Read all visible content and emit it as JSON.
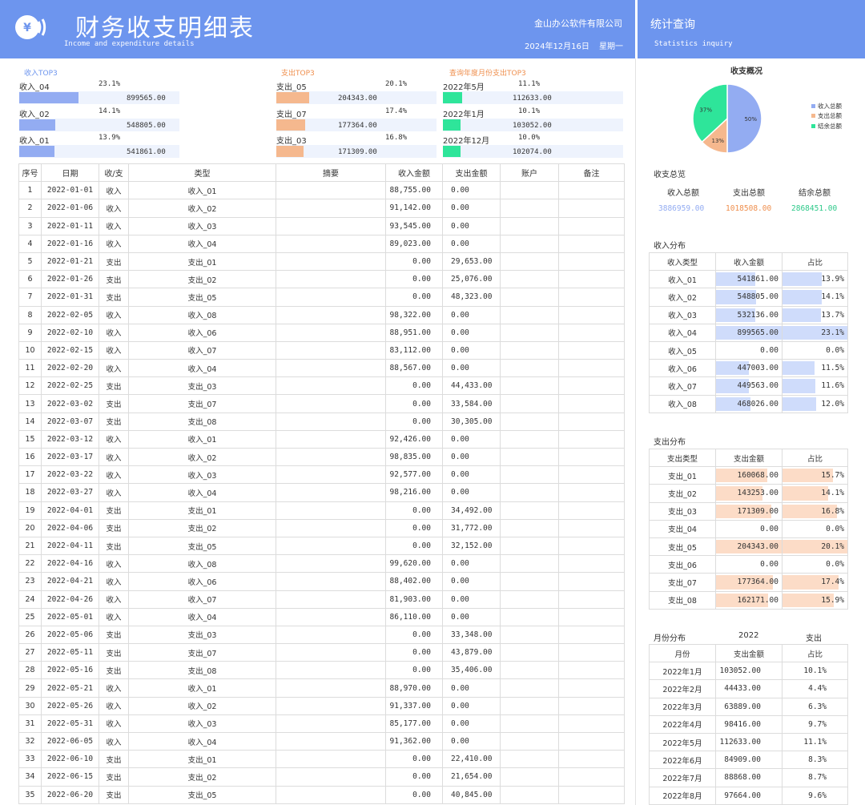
{
  "header": {
    "title": "财务收支明细表",
    "subtitle": "Income and expenditure details",
    "company": "金山办公软件有限公司",
    "date": "2024年12月16日",
    "weekday": "星期一",
    "logo_symbol": "¥"
  },
  "side_header": {
    "title": "统计查询",
    "subtitle": "Statistics  inquiry"
  },
  "colors": {
    "header": "#6d95ee",
    "income": "#93acf2",
    "expense": "#f5b88e",
    "balance": "#2ee59a",
    "income_fill": "#cfdcfb",
    "expense_fill": "#fcdcc7"
  },
  "top3": {
    "income": {
      "title": "收入TOP3",
      "items": [
        {
          "name": "收入_04",
          "pct": "23.1%",
          "amount": "899565.00",
          "ratio": 0.231
        },
        {
          "name": "收入_02",
          "pct": "14.1%",
          "amount": "548805.00",
          "ratio": 0.141
        },
        {
          "name": "收入_01",
          "pct": "13.9%",
          "amount": "541861.00",
          "ratio": 0.139
        }
      ]
    },
    "expense": {
      "title": "支出TOP3",
      "items": [
        {
          "name": "支出_05",
          "pct": "20.1%",
          "amount": "204343.00",
          "ratio": 0.201
        },
        {
          "name": "支出_07",
          "pct": "17.4%",
          "amount": "177364.00",
          "ratio": 0.174
        },
        {
          "name": "支出_03",
          "pct": "16.8%",
          "amount": "171309.00",
          "ratio": 0.168
        }
      ]
    },
    "month": {
      "title": "查询年度月份支出TOP3",
      "items": [
        {
          "name": "2022年5月",
          "pct": "11.1%",
          "amount": "112633.00",
          "ratio": 0.111
        },
        {
          "name": "2022年1月",
          "pct": "10.1%",
          "amount": "103052.00",
          "ratio": 0.101
        },
        {
          "name": "2022年12月",
          "pct": "10.0%",
          "amount": "102074.00",
          "ratio": 0.1
        }
      ]
    }
  },
  "table": {
    "headers": [
      "序号",
      "日期",
      "收/支",
      "类型",
      "摘要",
      "收入金额",
      "支出金额",
      "账户",
      "备注"
    ],
    "rows": [
      [
        "1",
        "2022-01-01",
        "收入",
        "收入_01",
        "",
        "88,755.00",
        "0.00",
        "",
        ""
      ],
      [
        "2",
        "2022-01-06",
        "收入",
        "收入_02",
        "",
        "91,142.00",
        "0.00",
        "",
        ""
      ],
      [
        "3",
        "2022-01-11",
        "收入",
        "收入_03",
        "",
        "93,545.00",
        "0.00",
        "",
        ""
      ],
      [
        "4",
        "2022-01-16",
        "收入",
        "收入_04",
        "",
        "89,023.00",
        "0.00",
        "",
        ""
      ],
      [
        "5",
        "2022-01-21",
        "支出",
        "支出_01",
        "",
        "0.00",
        "29,653.00",
        "",
        ""
      ],
      [
        "6",
        "2022-01-26",
        "支出",
        "支出_02",
        "",
        "0.00",
        "25,076.00",
        "",
        ""
      ],
      [
        "7",
        "2022-01-31",
        "支出",
        "支出_05",
        "",
        "0.00",
        "48,323.00",
        "",
        ""
      ],
      [
        "8",
        "2022-02-05",
        "收入",
        "收入_08",
        "",
        "98,322.00",
        "0.00",
        "",
        ""
      ],
      [
        "9",
        "2022-02-10",
        "收入",
        "收入_06",
        "",
        "88,951.00",
        "0.00",
        "",
        ""
      ],
      [
        "10",
        "2022-02-15",
        "收入",
        "收入_07",
        "",
        "83,112.00",
        "0.00",
        "",
        ""
      ],
      [
        "11",
        "2022-02-20",
        "收入",
        "收入_04",
        "",
        "88,567.00",
        "0.00",
        "",
        ""
      ],
      [
        "12",
        "2022-02-25",
        "支出",
        "支出_03",
        "",
        "0.00",
        "44,433.00",
        "",
        ""
      ],
      [
        "13",
        "2022-03-02",
        "支出",
        "支出_07",
        "",
        "0.00",
        "33,584.00",
        "",
        ""
      ],
      [
        "14",
        "2022-03-07",
        "支出",
        "支出_08",
        "",
        "0.00",
        "30,305.00",
        "",
        ""
      ],
      [
        "15",
        "2022-03-12",
        "收入",
        "收入_01",
        "",
        "92,426.00",
        "0.00",
        "",
        ""
      ],
      [
        "16",
        "2022-03-17",
        "收入",
        "收入_02",
        "",
        "98,835.00",
        "0.00",
        "",
        ""
      ],
      [
        "17",
        "2022-03-22",
        "收入",
        "收入_03",
        "",
        "92,577.00",
        "0.00",
        "",
        ""
      ],
      [
        "18",
        "2022-03-27",
        "收入",
        "收入_04",
        "",
        "98,216.00",
        "0.00",
        "",
        ""
      ],
      [
        "19",
        "2022-04-01",
        "支出",
        "支出_01",
        "",
        "0.00",
        "34,492.00",
        "",
        ""
      ],
      [
        "20",
        "2022-04-06",
        "支出",
        "支出_02",
        "",
        "0.00",
        "31,772.00",
        "",
        ""
      ],
      [
        "21",
        "2022-04-11",
        "支出",
        "支出_05",
        "",
        "0.00",
        "32,152.00",
        "",
        ""
      ],
      [
        "22",
        "2022-04-16",
        "收入",
        "收入_08",
        "",
        "99,620.00",
        "0.00",
        "",
        ""
      ],
      [
        "23",
        "2022-04-21",
        "收入",
        "收入_06",
        "",
        "88,402.00",
        "0.00",
        "",
        ""
      ],
      [
        "24",
        "2022-04-26",
        "收入",
        "收入_07",
        "",
        "81,903.00",
        "0.00",
        "",
        ""
      ],
      [
        "25",
        "2022-05-01",
        "收入",
        "收入_04",
        "",
        "86,110.00",
        "0.00",
        "",
        ""
      ],
      [
        "26",
        "2022-05-06",
        "支出",
        "支出_03",
        "",
        "0.00",
        "33,348.00",
        "",
        ""
      ],
      [
        "27",
        "2022-05-11",
        "支出",
        "支出_07",
        "",
        "0.00",
        "43,879.00",
        "",
        ""
      ],
      [
        "28",
        "2022-05-16",
        "支出",
        "支出_08",
        "",
        "0.00",
        "35,406.00",
        "",
        ""
      ],
      [
        "29",
        "2022-05-21",
        "收入",
        "收入_01",
        "",
        "88,970.00",
        "0.00",
        "",
        ""
      ],
      [
        "30",
        "2022-05-26",
        "收入",
        "收入_02",
        "",
        "91,337.00",
        "0.00",
        "",
        ""
      ],
      [
        "31",
        "2022-05-31",
        "收入",
        "收入_03",
        "",
        "85,177.00",
        "0.00",
        "",
        ""
      ],
      [
        "32",
        "2022-06-05",
        "收入",
        "收入_04",
        "",
        "91,362.00",
        "0.00",
        "",
        ""
      ],
      [
        "33",
        "2022-06-10",
        "支出",
        "支出_01",
        "",
        "0.00",
        "22,410.00",
        "",
        ""
      ],
      [
        "34",
        "2022-06-15",
        "支出",
        "支出_02",
        "",
        "0.00",
        "21,654.00",
        "",
        ""
      ],
      [
        "35",
        "2022-06-20",
        "支出",
        "支出_05",
        "",
        "0.00",
        "40,845.00",
        "",
        ""
      ]
    ]
  },
  "overview": {
    "title": "收支概况",
    "legend": [
      "收入总额",
      "支出总额",
      "结余总额"
    ],
    "slice_labels": [
      "50%",
      "13%",
      "37%"
    ]
  },
  "chart_data": {
    "type": "pie",
    "title": "收支概况",
    "labels": [
      "收入总额",
      "支出总额",
      "结余总额"
    ],
    "values": [
      3886959.0,
      1018508.0,
      2868451.0
    ],
    "percent_labels": [
      "50%",
      "13%",
      "37%"
    ],
    "colors": [
      "#93acf2",
      "#f5b88e",
      "#2ee59a"
    ],
    "legend_position": "right"
  },
  "summary": {
    "title": "收支总览",
    "labels": [
      "收入总额",
      "支出总额",
      "结余总额"
    ],
    "values": [
      "3886959.00",
      "1018508.00",
      "2868451.00"
    ]
  },
  "income_dist": {
    "title": "收入分布",
    "headers": [
      "收入类型",
      "收入金额",
      "占比"
    ],
    "rows": [
      {
        "name": "收入_01",
        "amount": "541861.00",
        "pct": "13.9%",
        "ratio": 0.139
      },
      {
        "name": "收入_02",
        "amount": "548805.00",
        "pct": "14.1%",
        "ratio": 0.141
      },
      {
        "name": "收入_03",
        "amount": "532136.00",
        "pct": "13.7%",
        "ratio": 0.137
      },
      {
        "name": "收入_04",
        "amount": "899565.00",
        "pct": "23.1%",
        "ratio": 0.231
      },
      {
        "name": "收入_05",
        "amount": "0.00",
        "pct": "0.0%",
        "ratio": 0
      },
      {
        "name": "收入_06",
        "amount": "447003.00",
        "pct": "11.5%",
        "ratio": 0.115
      },
      {
        "name": "收入_07",
        "amount": "449563.00",
        "pct": "11.6%",
        "ratio": 0.116
      },
      {
        "name": "收入_08",
        "amount": "468026.00",
        "pct": "12.0%",
        "ratio": 0.12
      }
    ]
  },
  "expense_dist": {
    "title": "支出分布",
    "headers": [
      "支出类型",
      "支出金额",
      "占比"
    ],
    "rows": [
      {
        "name": "支出_01",
        "amount": "160068.00",
        "pct": "15.7%",
        "ratio": 0.157
      },
      {
        "name": "支出_02",
        "amount": "143253.00",
        "pct": "14.1%",
        "ratio": 0.141
      },
      {
        "name": "支出_03",
        "amount": "171309.00",
        "pct": "16.8%",
        "ratio": 0.168
      },
      {
        "name": "支出_04",
        "amount": "0.00",
        "pct": "0.0%",
        "ratio": 0
      },
      {
        "name": "支出_05",
        "amount": "204343.00",
        "pct": "20.1%",
        "ratio": 0.201
      },
      {
        "name": "支出_06",
        "amount": "0.00",
        "pct": "0.0%",
        "ratio": 0
      },
      {
        "name": "支出_07",
        "amount": "177364.00",
        "pct": "17.4%",
        "ratio": 0.174
      },
      {
        "name": "支出_08",
        "amount": "162171.00",
        "pct": "15.9%",
        "ratio": 0.159
      }
    ]
  },
  "month_dist": {
    "title": "月份分布",
    "year": "2022",
    "kind": "支出",
    "headers": [
      "月份",
      "支出金额",
      "占比"
    ],
    "rows": [
      {
        "name": "2022年1月",
        "amount": "103052.00",
        "pct": "10.1%"
      },
      {
        "name": "2022年2月",
        "amount": "44433.00",
        "pct": "4.4%"
      },
      {
        "name": "2022年3月",
        "amount": "63889.00",
        "pct": "6.3%"
      },
      {
        "name": "2022年4月",
        "amount": "98416.00",
        "pct": "9.7%"
      },
      {
        "name": "2022年5月",
        "amount": "112633.00",
        "pct": "11.1%"
      },
      {
        "name": "2022年6月",
        "amount": "84909.00",
        "pct": "8.3%"
      },
      {
        "name": "2022年7月",
        "amount": "88868.00",
        "pct": "8.7%"
      },
      {
        "name": "2022年8月",
        "amount": "97664.00",
        "pct": "9.6%"
      }
    ]
  }
}
